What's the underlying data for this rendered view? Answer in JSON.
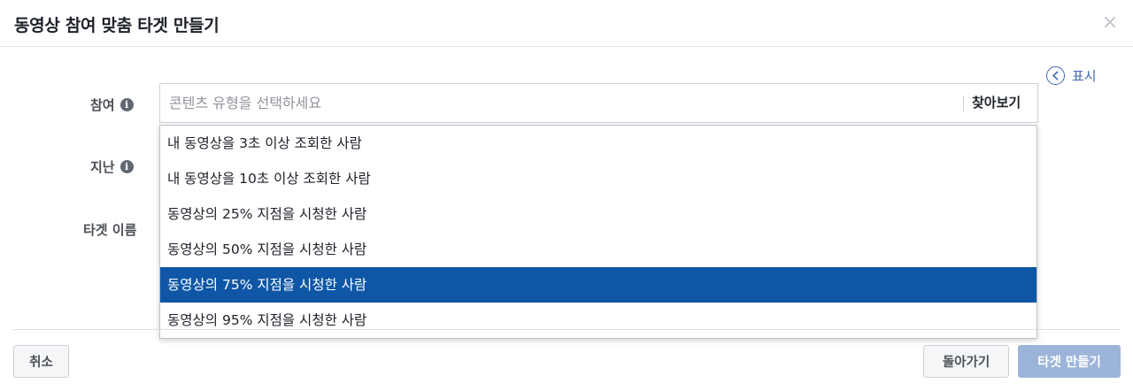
{
  "dialog": {
    "title": "동영상 참여 맞춤 타겟 만들기",
    "close_glyph": "×",
    "show_link": {
      "arrow": "‹",
      "label": "표시"
    }
  },
  "form": {
    "engagement_label": "참여",
    "retention_label": "지난",
    "audience_name_label": "타겟 이름",
    "info_glyph": "i",
    "search": {
      "placeholder": "콘텐츠 유형을 선택하세요",
      "value": "",
      "browse_label": "찾아보기"
    }
  },
  "dropdown": {
    "options": [
      "내 동영상을 3초 이상 조회한 사람",
      "내 동영상을 10초 이상 조회한 사람",
      "동영상의 25% 지점을 시청한 사람",
      "동영상의 50% 지점을 시청한 사람",
      "동영상의 75% 지점을 시청한 사람",
      "동영상의 95% 지점을 시청한 사람"
    ],
    "selected": "동영상의 75% 지점을 시청한 사람"
  },
  "footer": {
    "cancel_label": "취소",
    "back_label": "돌아가기",
    "create_label": "타겟 만들기"
  },
  "colors": {
    "accent": "#4267b2",
    "selected_option": "#0f57a6",
    "create_disabled": "#9cb4d8"
  }
}
